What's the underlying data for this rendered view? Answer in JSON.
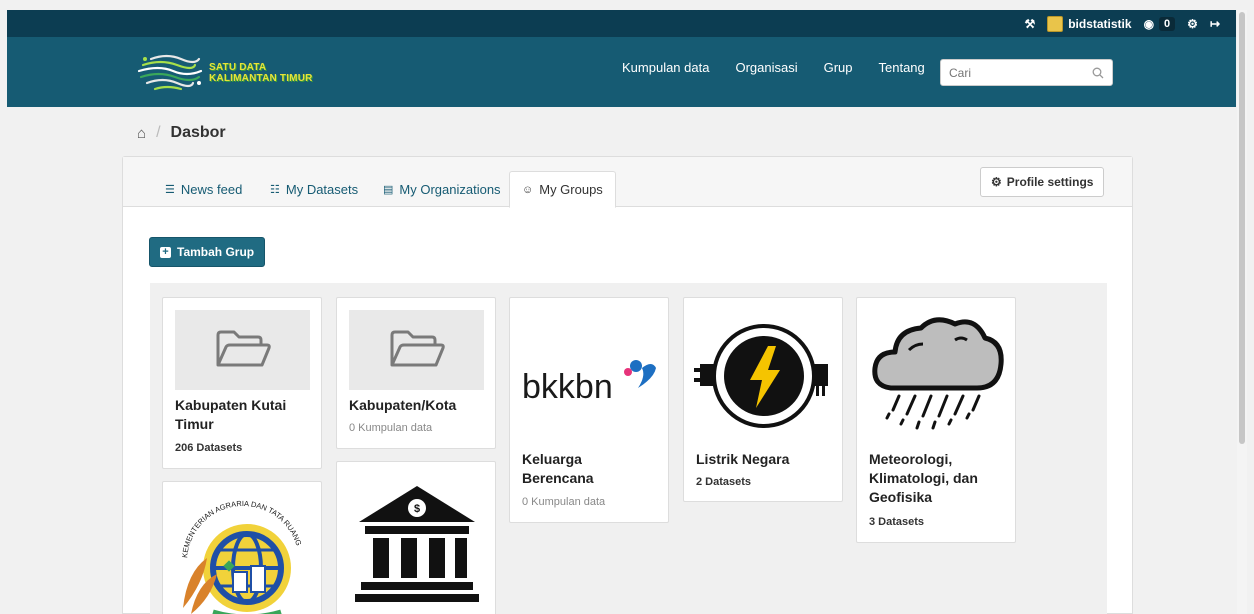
{
  "topbar": {
    "user_name": "bidstatistik",
    "notif_count": "0"
  },
  "brand": {
    "line1": "SATU DATA",
    "line2": "KALIMANTAN TIMUR"
  },
  "nav": {
    "items": [
      "Kumpulan data",
      "Organisasi",
      "Grup",
      "Tentang"
    ]
  },
  "search": {
    "placeholder": "Cari"
  },
  "breadcrumb": {
    "current": "Dasbor"
  },
  "tabs": [
    {
      "label": "News feed",
      "icon": "list-icon"
    },
    {
      "label": "My Datasets",
      "icon": "sitemap-icon"
    },
    {
      "label": "My Organizations",
      "icon": "building-icon"
    },
    {
      "label": "My Groups",
      "icon": "users-icon"
    }
  ],
  "profile_button": "Profile settings",
  "add_group_button": "Tambah Grup",
  "groups": [
    {
      "title": "Kabupaten Kutai Timur",
      "count": "206 Datasets",
      "image": "folder-placeholder"
    },
    {
      "title": "Kabupaten/Kota",
      "count": "0 Kumpulan data",
      "image": "folder-placeholder"
    },
    {
      "title": "Keluarga Berencana",
      "count": "0 Kumpulan data",
      "image": "bkkbn-logo"
    },
    {
      "title": "Listrik Negara",
      "count": "2 Datasets",
      "image": "electric-plug-logo"
    },
    {
      "title": "Meteorologi, Klimatologi, dan Geofisika",
      "count": "3 Datasets",
      "image": "rain-cloud-logo"
    }
  ],
  "logos": {
    "bkkbn": "bkkbn",
    "atr_arc_text": "KEMENTERIAN AGRARIA DAN TATA RUANG"
  },
  "colors": {
    "topbar": "#0c3d52",
    "masthead": "#165b73",
    "accent": "#206b82"
  }
}
